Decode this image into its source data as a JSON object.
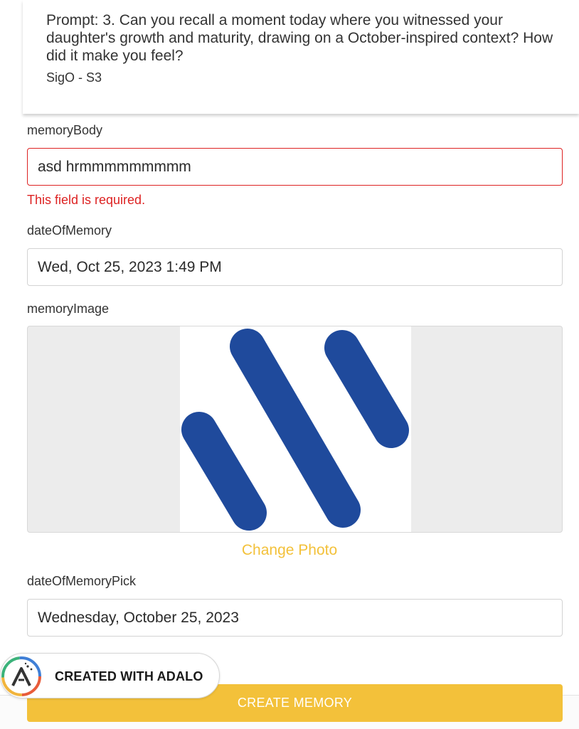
{
  "prompt": {
    "text": "Prompt: 3. Can you recall a moment today where you witnessed your daughter's growth and maturity, drawing on a October-inspired context? How did it make you feel?",
    "subtitle": "SigO - S3"
  },
  "form": {
    "memory_body": {
      "label": "memoryBody",
      "value": "asd hrmmmmmmmmm",
      "error": "This field is required."
    },
    "date_of_memory": {
      "label": "dateOfMemory",
      "value": "Wed, Oct 25, 2023 1:49 PM"
    },
    "memory_image": {
      "label": "memoryImage",
      "change_label": "Change Photo"
    },
    "date_of_memory_pick": {
      "label": "dateOfMemoryPick",
      "value": "Wednesday, October 25, 2023"
    },
    "submit_label": "CREATE MEMORY"
  },
  "badge": {
    "text": "CREATED WITH ADALO"
  },
  "colors": {
    "accent": "#f3c13a",
    "error": "#dd2222",
    "image_stripes": "#1f4a9c"
  }
}
